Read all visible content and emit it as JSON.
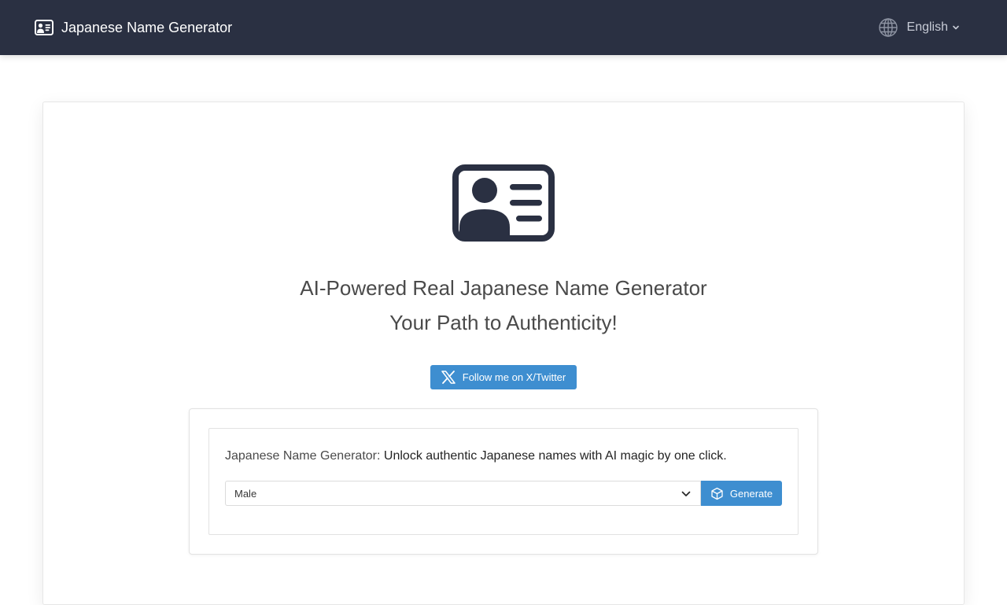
{
  "colors": {
    "navbar_bg": "#2a3042",
    "accent": "#3e8ed0",
    "icon_dark": "#2a3042"
  },
  "navbar": {
    "brand_icon": "id-card-icon",
    "brand_text": "Japanese Name Generator",
    "language_icon": "globe-icon",
    "language_label": "English"
  },
  "hero": {
    "icon": "id-card-icon",
    "title_line1": "AI-Powered Real Japanese Name Generator",
    "title_line2": "Your Path to Authenticity!"
  },
  "social": {
    "icon": "x-twitter-icon",
    "follow_label": "Follow me on X/Twitter"
  },
  "generator": {
    "label": "Japanese Name Generator:",
    "description": "Unlock authentic Japanese names with AI magic by one click.",
    "gender_value": "Male",
    "generate_label": "Generate",
    "generate_icon": "cube-icon"
  }
}
